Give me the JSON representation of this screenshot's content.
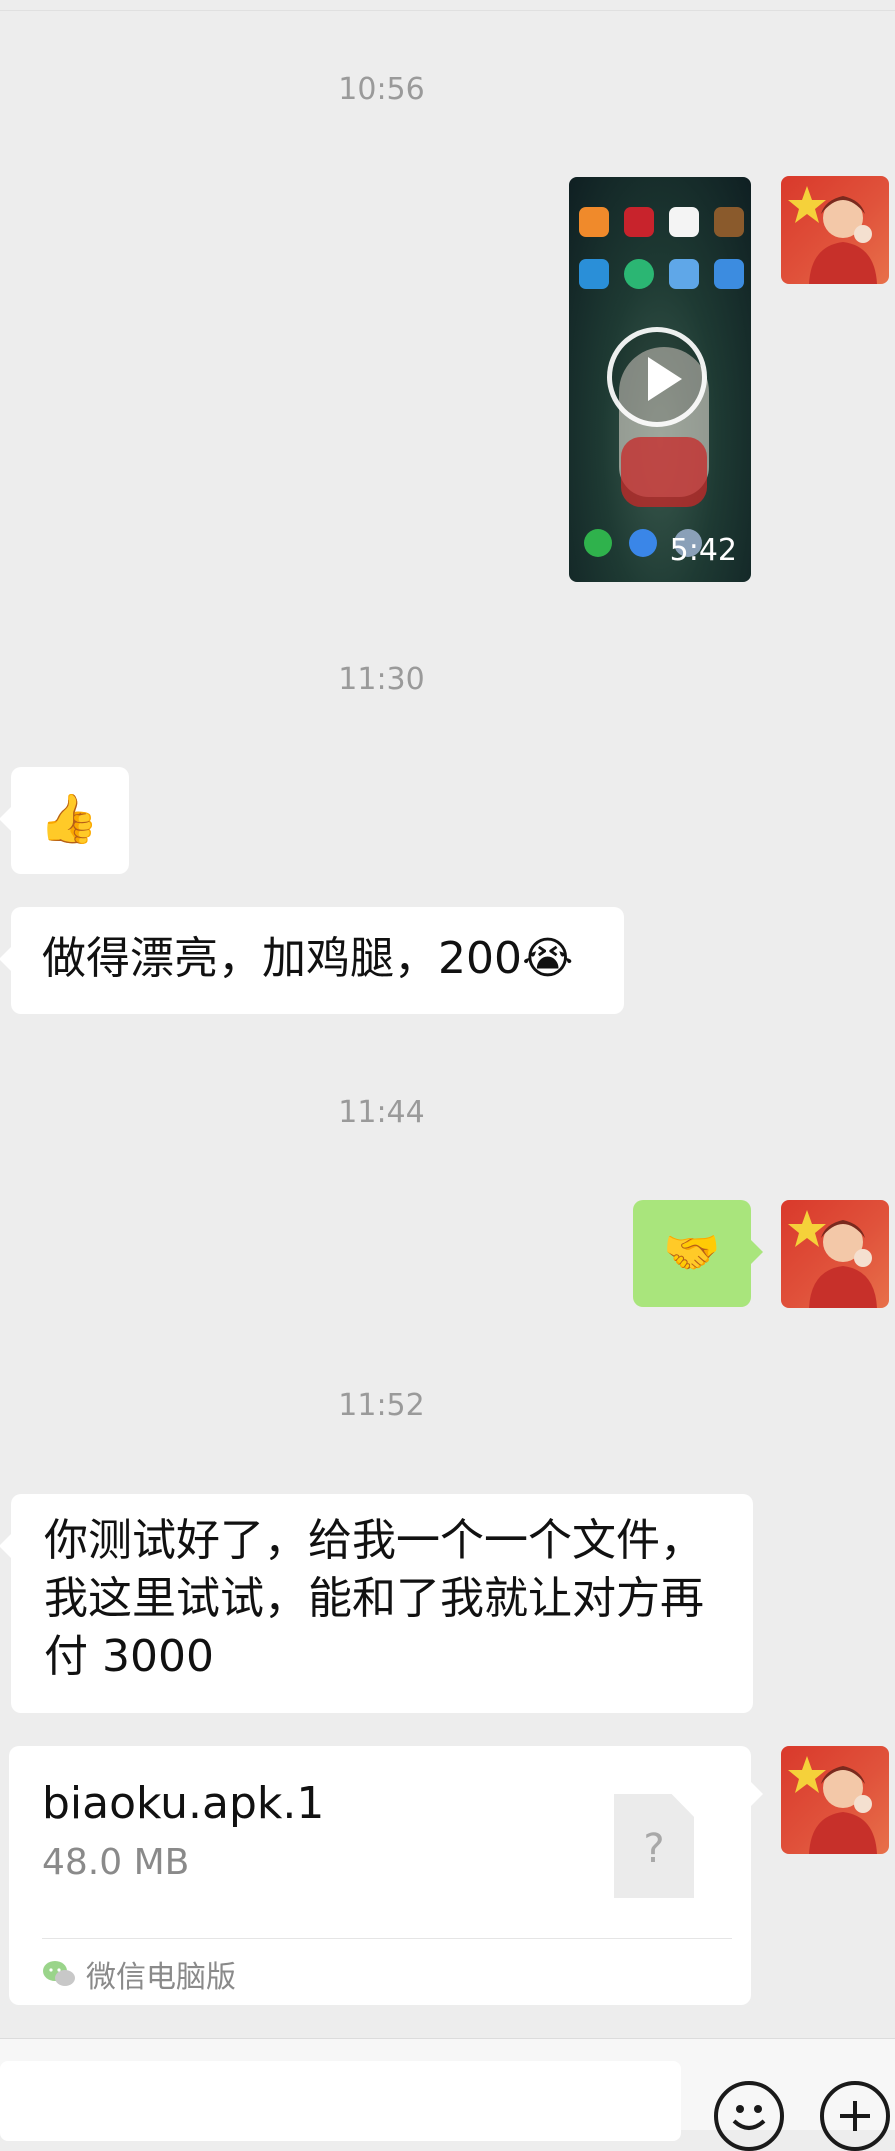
{
  "timestamps": [
    "10:56",
    "11:30",
    "11:44",
    "11:52"
  ],
  "video": {
    "duration": "5:42"
  },
  "messages": {
    "thumbs_up": "👍",
    "msg1": "做得漂亮，加鸡腿，200😭",
    "handshake": "🤝",
    "msg2": "你测试好了，给我一个一个文件，我这里试试，能和了我就让对方再付 3000"
  },
  "file": {
    "name": "biaoku.apk.1",
    "size": "48.0 MB",
    "icon_glyph": "?",
    "source": "微信电脑版"
  },
  "colors": {
    "background": "#ededed",
    "sent_bubble": "#a9e57c",
    "received_bubble": "#ffffff",
    "timestamp_text": "#9a9a9a",
    "avatar_red": "#d9392b",
    "star_yellow": "#f5d13a"
  },
  "icons": [
    "play-icon",
    "file-unknown-icon",
    "wechat-pc-icon",
    "emoji-icon",
    "plus-icon"
  ]
}
